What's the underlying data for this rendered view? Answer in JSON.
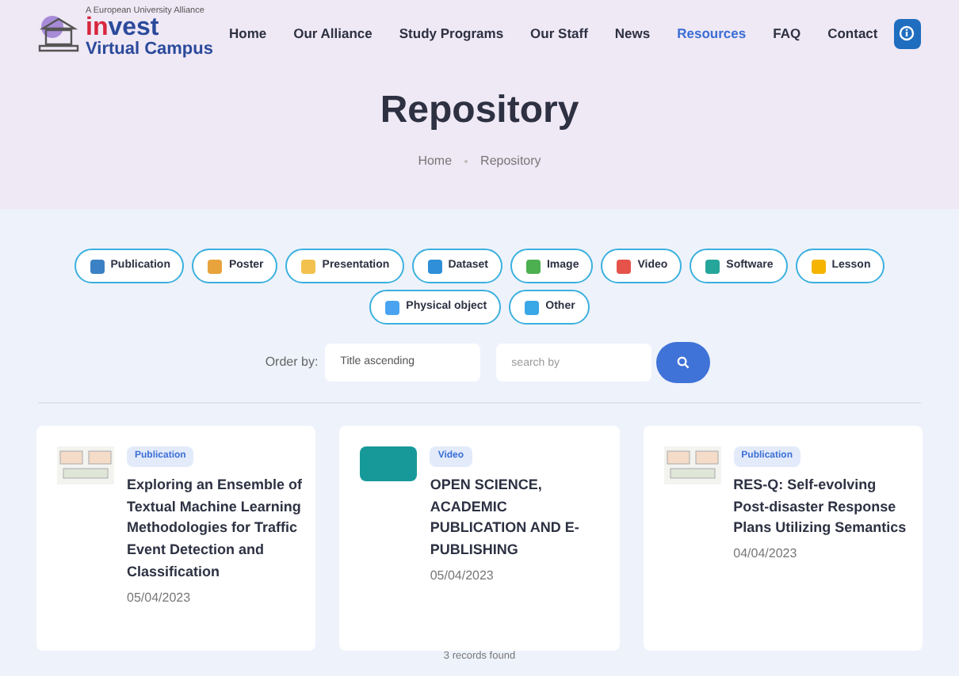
{
  "logo": {
    "tagline": "A European University Alliance",
    "name_part_1": "in",
    "name_part_2": "vest",
    "subtitle": "Virtual Campus"
  },
  "nav": [
    {
      "label": "Home",
      "selected": false
    },
    {
      "label": "Our Alliance",
      "selected": false
    },
    {
      "label": "Study Programs",
      "selected": false
    },
    {
      "label": "Our Staff",
      "selected": false
    },
    {
      "label": "News",
      "selected": false
    },
    {
      "label": "Resources",
      "selected": true
    },
    {
      "label": "FAQ",
      "selected": false
    },
    {
      "label": "Contact",
      "selected": false
    }
  ],
  "page_title": "Repository",
  "breadcrumb": [
    "Home",
    "Repository"
  ],
  "filters": [
    {
      "label": "Publication",
      "color": "#3b82c4"
    },
    {
      "label": "Poster",
      "color": "#e8a33d"
    },
    {
      "label": "Presentation",
      "color": "#f2c14e"
    },
    {
      "label": "Dataset",
      "color": "#2f8fd8"
    },
    {
      "label": "Image",
      "color": "#4caf50"
    },
    {
      "label": "Video",
      "color": "#e5534b"
    },
    {
      "label": "Software",
      "color": "#26a69a"
    },
    {
      "label": "Lesson",
      "color": "#f5b400"
    },
    {
      "label": "Physical object",
      "color": "#4aa3f0"
    },
    {
      "label": "Other",
      "color": "#3aa7e6"
    }
  ],
  "order": {
    "label": "Order by:",
    "value": "Title ascending"
  },
  "search": {
    "placeholder": "search by"
  },
  "results": [
    {
      "kind": "diagram",
      "type": "Publication",
      "title": "Exploring an Ensemble of Textual Machine Learning Methodologies for Traffic Event Detection and Classification",
      "date": "05/04/2023"
    },
    {
      "kind": "video",
      "type": "Video",
      "title": "OPEN SCIENCE, ACADEMIC PUBLICATION AND E-PUBLISHING",
      "date": "05/04/2023"
    },
    {
      "kind": "diagram",
      "type": "Publication",
      "title": "RES-Q: Self-evolving Post-disaster Response Plans Utilizing Semantics",
      "date": "04/04/2023"
    }
  ],
  "records_found": "3 records found"
}
